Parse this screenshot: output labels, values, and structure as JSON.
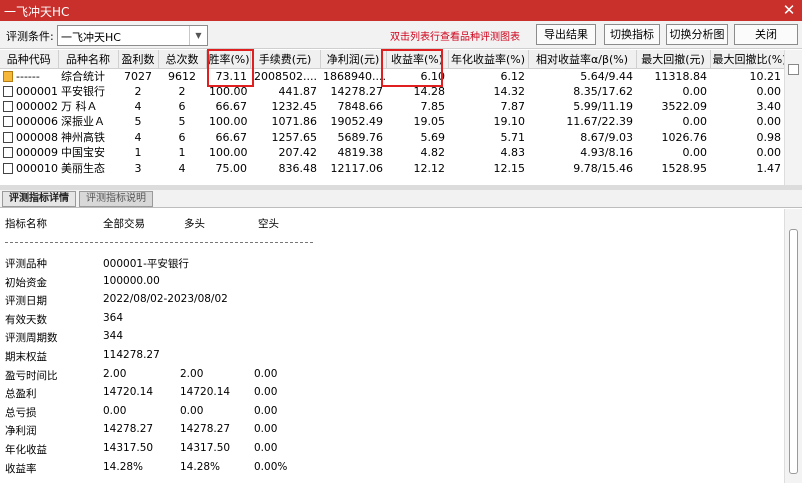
{
  "window": {
    "title": "一飞冲天HC",
    "close_glyph": "✕"
  },
  "toolbar": {
    "condition_label": "评测条件:",
    "condition_value": "一飞冲天HC",
    "hint": "双击列表行查看品种评测图表",
    "buttons": {
      "export": "导出结果",
      "switch_metric": "切换指标",
      "switch_chart": "切换分析图",
      "close": "关闭"
    }
  },
  "grid": {
    "columns": [
      "品种代码",
      "品种名称",
      "盈利数",
      "总次数",
      "胜率(%)",
      "手续费(元)",
      "净利润(元)",
      "收益率(%)",
      "年化收益率(%)",
      "相对收益率α/β(%)",
      "最大回撤(元)",
      "最大回撤比(%)"
    ],
    "rows": [
      {
        "code": "------",
        "icon": "folder-icon",
        "name": "综合统计",
        "win": "7027",
        "total": "9612",
        "winrate": "73.11",
        "fee": "2008502....",
        "net": "1868940....",
        "ret": "6.10",
        "annual": "6.12",
        "rel": "5.64/9.44",
        "mdd": "11318.84",
        "mddr": "10.21"
      },
      {
        "code": "000001",
        "icon": "doc-icon",
        "name": "平安银行",
        "win": "2",
        "total": "2",
        "winrate": "100.00",
        "fee": "441.87",
        "net": "14278.27",
        "ret": "14.28",
        "annual": "14.32",
        "rel": "8.35/17.62",
        "mdd": "0.00",
        "mddr": "0.00"
      },
      {
        "code": "000002",
        "icon": "doc-icon",
        "name": "万 科Ａ",
        "win": "4",
        "total": "6",
        "winrate": "66.67",
        "fee": "1232.45",
        "net": "7848.66",
        "ret": "7.85",
        "annual": "7.87",
        "rel": "5.99/11.19",
        "mdd": "3522.09",
        "mddr": "3.40"
      },
      {
        "code": "000006",
        "icon": "doc-icon",
        "name": "深振业Ａ",
        "win": "5",
        "total": "5",
        "winrate": "100.00",
        "fee": "1071.86",
        "net": "19052.49",
        "ret": "19.05",
        "annual": "19.10",
        "rel": "11.67/22.39",
        "mdd": "0.00",
        "mddr": "0.00"
      },
      {
        "code": "000008",
        "icon": "doc-icon",
        "name": "神州高铁",
        "win": "4",
        "total": "6",
        "winrate": "66.67",
        "fee": "1257.65",
        "net": "5689.76",
        "ret": "5.69",
        "annual": "5.71",
        "rel": "8.67/9.03",
        "mdd": "1026.76",
        "mddr": "0.98"
      },
      {
        "code": "000009",
        "icon": "doc-icon",
        "name": "中国宝安",
        "win": "1",
        "total": "1",
        "winrate": "100.00",
        "fee": "207.42",
        "net": "4819.38",
        "ret": "4.82",
        "annual": "4.83",
        "rel": "4.93/8.16",
        "mdd": "0.00",
        "mddr": "0.00"
      },
      {
        "code": "000010",
        "icon": "doc-icon",
        "name": "美丽生态",
        "win": "3",
        "total": "4",
        "winrate": "75.00",
        "fee": "836.48",
        "net": "12117.06",
        "ret": "12.12",
        "annual": "12.15",
        "rel": "9.78/15.46",
        "mdd": "1528.95",
        "mddr": "1.47"
      }
    ]
  },
  "tabs": {
    "detail": "评测指标详情",
    "desc": "评测指标说明"
  },
  "detail": {
    "headers": {
      "name": "指标名称",
      "all": "全部交易",
      "long": "多头",
      "short": "空头"
    },
    "lines": [
      {
        "label": "评测品种",
        "v1": "000001-平安银行",
        "v2": "",
        "v3": ""
      },
      {
        "label": "初始资金",
        "v1": "100000.00",
        "v2": "",
        "v3": ""
      },
      {
        "label": "评测日期",
        "v1": "2022/08/02-2023/08/02",
        "v2": "",
        "v3": ""
      },
      {
        "label": "有效天数",
        "v1": "364",
        "v2": "",
        "v3": ""
      },
      {
        "label": "评测周期数",
        "v1": "344",
        "v2": "",
        "v3": ""
      },
      {
        "label": "期末权益",
        "v1": "114278.27",
        "v2": "",
        "v3": ""
      },
      {
        "label": "盈亏时间比",
        "v1": "2.00",
        "v2": "2.00",
        "v3": "0.00"
      },
      {
        "label": "总盈利",
        "v1": "14720.14",
        "v2": "14720.14",
        "v3": "0.00"
      },
      {
        "label": "总亏损",
        "v1": "0.00",
        "v2": "0.00",
        "v3": "0.00"
      },
      {
        "label": "净利润",
        "v1": "14278.27",
        "v2": "14278.27",
        "v3": "0.00"
      },
      {
        "label": "年化收益",
        "v1": "14317.50",
        "v2": "14317.50",
        "v3": "0.00"
      },
      {
        "label": "收益率",
        "v1": "14.28%",
        "v2": "14.28%",
        "v3": "0.00%"
      }
    ]
  },
  "colors": {
    "titlebar": "#c9302c",
    "highlight": "#e02020",
    "hint": "#d0021b"
  }
}
